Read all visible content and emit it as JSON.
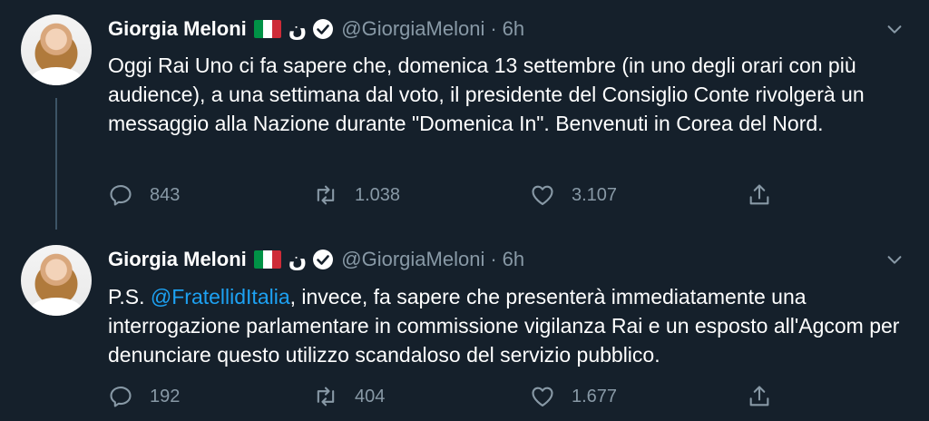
{
  "tweets": [
    {
      "author_name": "Giorgia Meloni",
      "author_extra": "ن",
      "handle": "@GiorgiaMeloni",
      "separator": "·",
      "time": "6h",
      "text": "Oggi Rai Uno ci fa sapere che, domenica 13 settembre (in uno degli orari con più audience), a una settimana dal voto, il presidente del Consiglio Conte rivolgerà un messaggio alla Nazione durante \"Domenica In\". Benvenuti in Corea del Nord.",
      "replies": "843",
      "retweets": "1.038",
      "likes": "3.107"
    },
    {
      "author_name": "Giorgia Meloni",
      "author_extra": "ن",
      "handle": "@GiorgiaMeloni",
      "separator": "·",
      "time": "6h",
      "text_prefix": "P.S. ",
      "mention": "@FratellidItalia",
      "text_suffix": ", invece, fa sapere che presenterà immediatamente una interrogazione parlamentare in commissione vigilanza Rai e un esposto all'Agcom per denunciare questo utilizzo scandaloso del servizio pubblico.",
      "replies": "192",
      "retweets": "404",
      "likes": "1.677"
    }
  ],
  "icons": {
    "flag": "italy-flag-icon",
    "verified": "verified-badge-icon",
    "menu": "chevron-down-icon",
    "reply": "reply-icon",
    "retweet": "retweet-icon",
    "like": "heart-icon",
    "share": "share-icon"
  },
  "colors": {
    "background": "#15202b",
    "text": "#ffffff",
    "secondary": "#8899a6",
    "link": "#1da1f2",
    "flag_green": "#009246",
    "flag_white": "#ffffff",
    "flag_red": "#ce2b37"
  }
}
